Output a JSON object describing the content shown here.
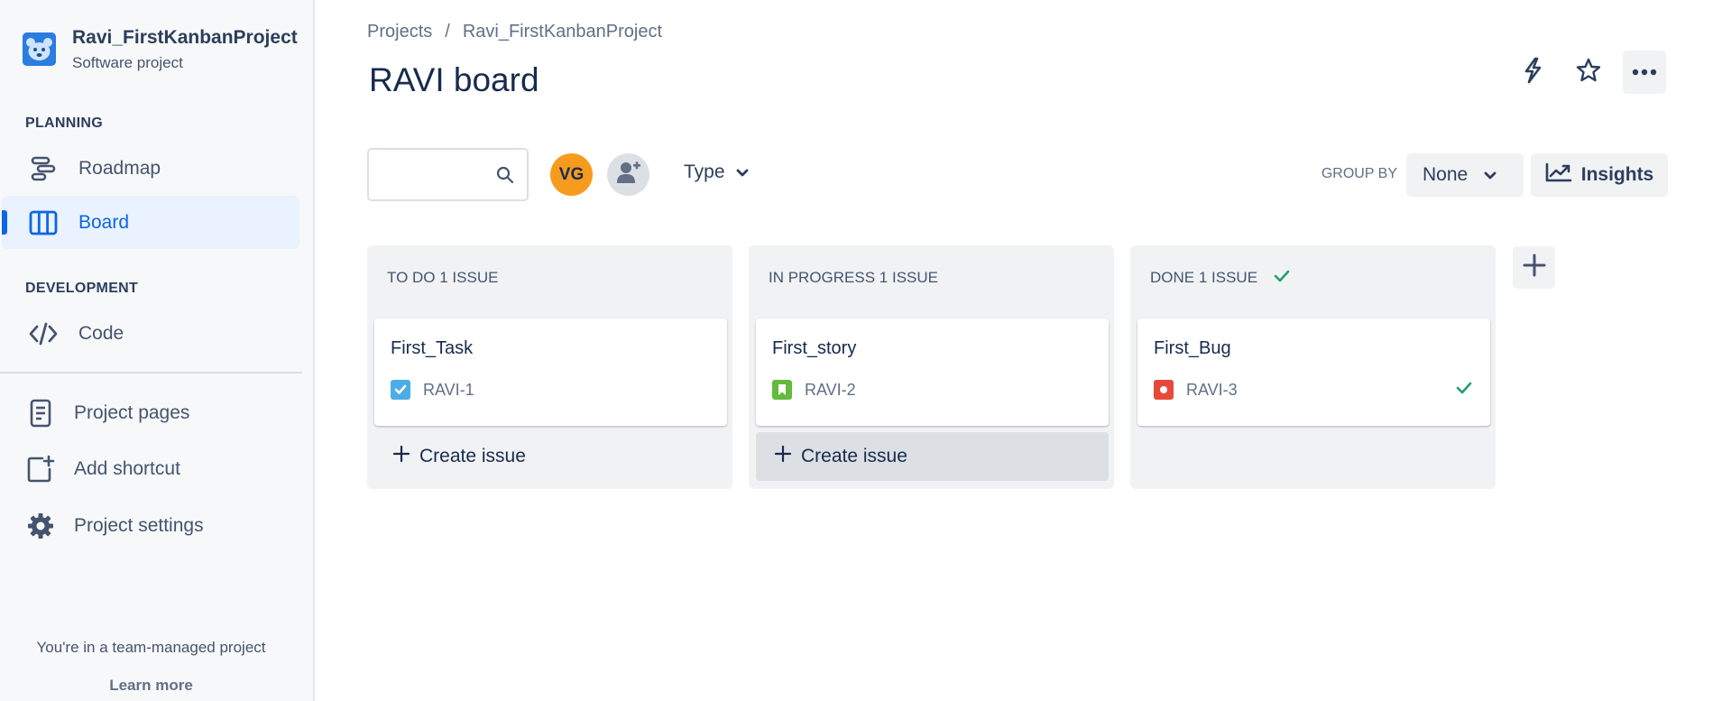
{
  "project": {
    "name": "Ravi_FirstKanbanProject",
    "type": "Software project"
  },
  "sidebar": {
    "planning_label": "PLANNING",
    "development_label": "DEVELOPMENT",
    "items": [
      {
        "label": "Roadmap",
        "icon": "roadmap-icon"
      },
      {
        "label": "Board",
        "icon": "board-icon",
        "active": true
      },
      {
        "label": "Code",
        "icon": "code-icon"
      },
      {
        "label": "Project pages",
        "icon": "page-icon"
      },
      {
        "label": "Add shortcut",
        "icon": "add-shortcut-icon"
      },
      {
        "label": "Project settings",
        "icon": "gear-icon"
      }
    ],
    "footer_text": "You're in a team-managed project",
    "footer_link": "Learn more"
  },
  "breadcrumb": {
    "items": [
      "Projects",
      "Ravi_FirstKanbanProject"
    ],
    "separator": "/"
  },
  "header": {
    "title": "RAVI board",
    "actions": [
      "lightning-icon",
      "star-icon",
      "more-icon"
    ]
  },
  "filters": {
    "search_value": "",
    "avatar_initials": "VG",
    "type_label": "Type",
    "group_by_label": "GROUP BY",
    "group_by_value": "None",
    "insights_label": "Insights"
  },
  "columns": [
    {
      "header": "TO DO 1 ISSUE",
      "done": false,
      "card": {
        "title": "First_Task",
        "key": "RAVI-1",
        "issue_type": "task",
        "resolved": false
      },
      "create_label": "Create issue",
      "create_visible": true
    },
    {
      "header": "IN PROGRESS 1 ISSUE",
      "done": false,
      "card": {
        "title": "First_story",
        "key": "RAVI-2",
        "issue_type": "story",
        "resolved": false
      },
      "create_label": "Create issue",
      "create_visible": true
    },
    {
      "header": "DONE 1 ISSUE",
      "done": true,
      "card": {
        "title": "First_Bug",
        "key": "RAVI-3",
        "issue_type": "bug",
        "resolved": true
      },
      "create_label": "",
      "create_visible": false
    }
  ],
  "colors": {
    "accent": "#0c66e4",
    "avatar_orange": "#f79b1e",
    "task_blue": "#4bade8",
    "story_green": "#63ba3c",
    "bug_red": "#e5493a",
    "done_green": "#22a06b"
  }
}
